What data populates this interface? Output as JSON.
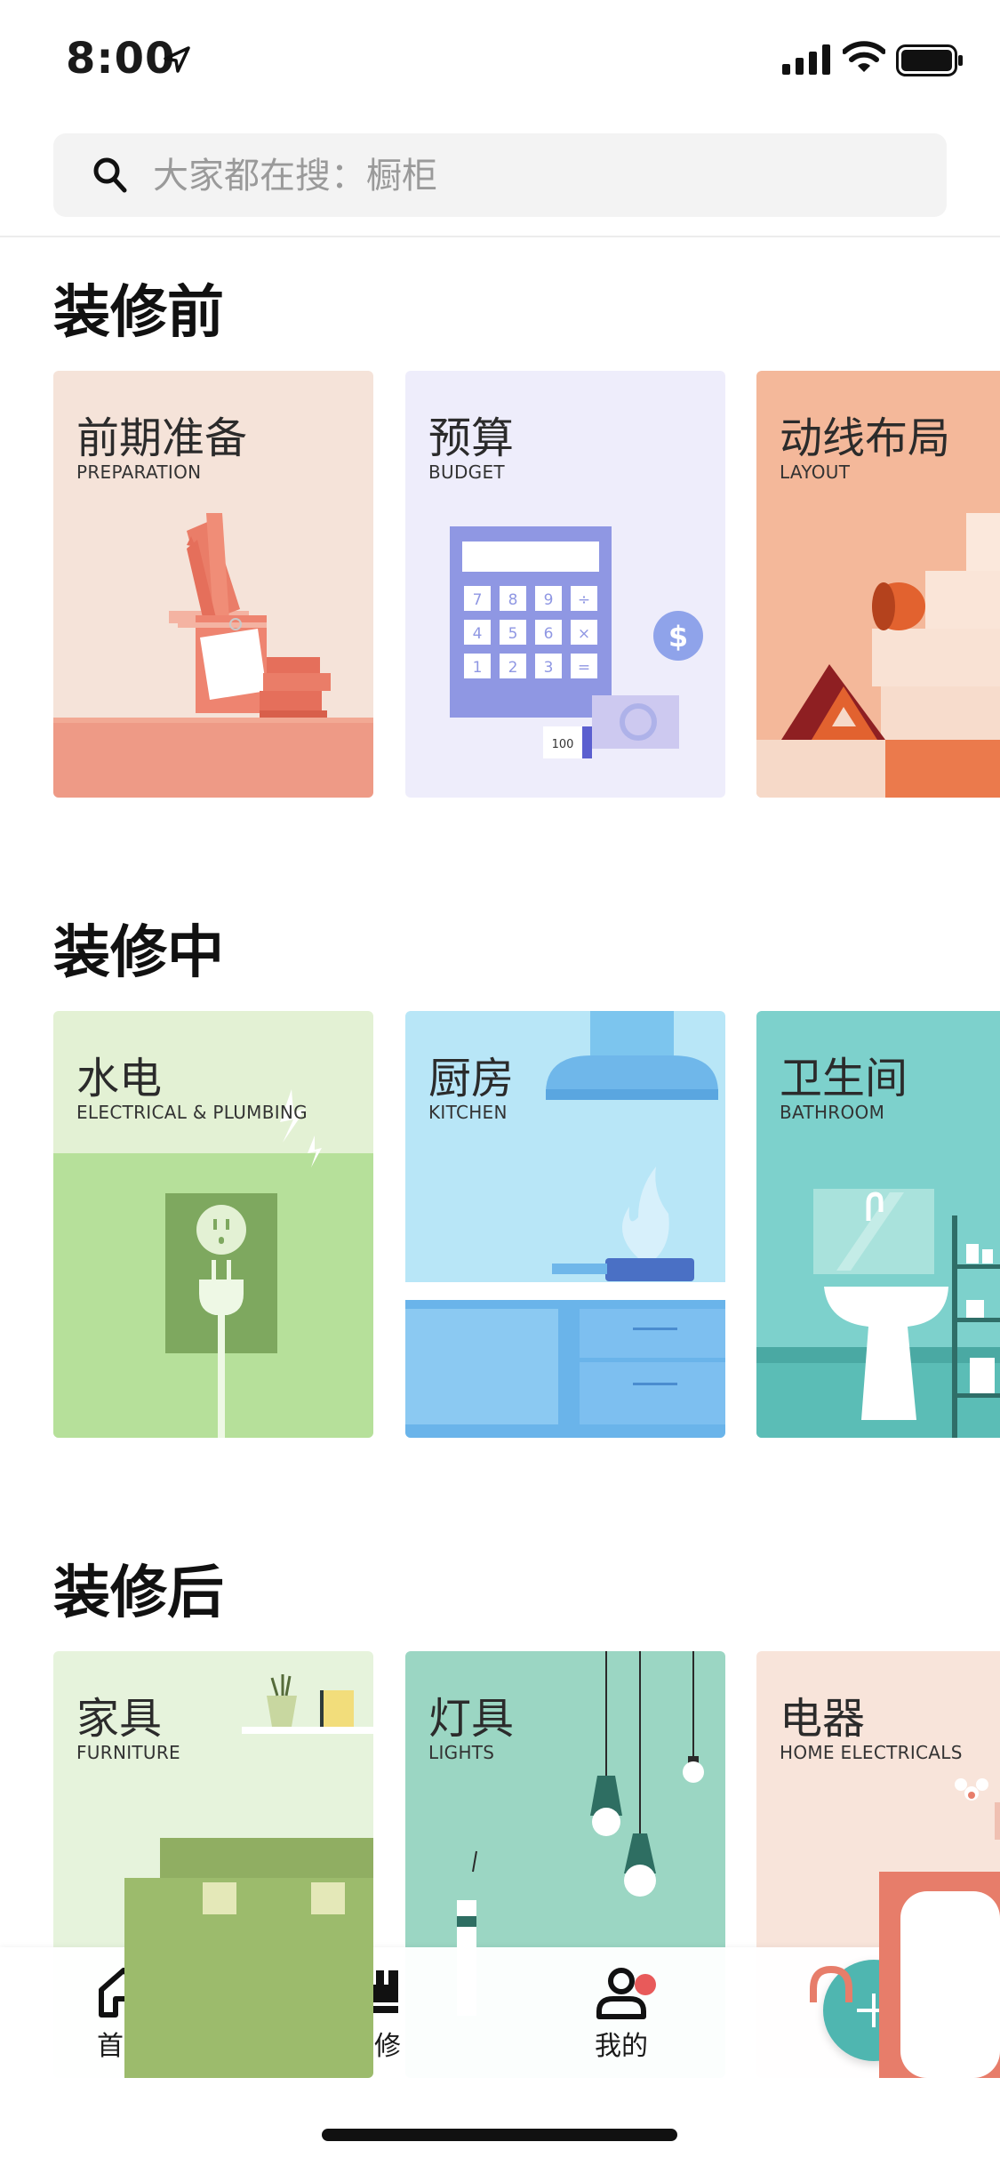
{
  "status_bar": {
    "time": "8:00"
  },
  "search": {
    "placeholder": "大家都在搜：橱柜"
  },
  "sections": [
    {
      "title": "装修前",
      "cards": [
        {
          "title": "前期准备",
          "subtitle": "PREPARATION",
          "bg": "#f5e3d9"
        },
        {
          "title": "预算",
          "subtitle": "BUDGET",
          "bg": "#eeedfb"
        },
        {
          "title": "动线布局",
          "subtitle": "LAYOUT",
          "bg": "#f4b89a"
        }
      ]
    },
    {
      "title": "装修中",
      "cards": [
        {
          "title": "水电",
          "subtitle": "ELECTRICAL & PLUMBING",
          "bg": "#e3f1d4"
        },
        {
          "title": "厨房",
          "subtitle": "KITCHEN",
          "bg": "#b8e6f7"
        },
        {
          "title": "卫生间",
          "subtitle": "BATHROOM",
          "bg": "#7dd1cc"
        }
      ]
    },
    {
      "title": "装修后",
      "cards": [
        {
          "title": "家具",
          "subtitle": "FURNITURE",
          "bg": "#e6f3dc"
        },
        {
          "title": "灯具",
          "subtitle": "LIGHTS",
          "bg": "#9bd6c3"
        },
        {
          "title": "电器",
          "subtitle": "HOME ELECTRICALS",
          "bg": "#f8e4da"
        }
      ]
    }
  ],
  "budget_illustration": {
    "keys": [
      "7",
      "8",
      "9",
      "÷",
      "4",
      "5",
      "6",
      "×",
      "1",
      "2",
      "3",
      "="
    ],
    "receipt": "100",
    "coin": "$"
  },
  "tab_bar": {
    "items": [
      {
        "label": "首页",
        "icon": "home-icon"
      },
      {
        "label": "装修",
        "icon": "roller-icon"
      },
      {
        "label": "我的",
        "icon": "user-icon"
      }
    ],
    "fab_label": "+"
  },
  "colors": {
    "accent": "#4fb6b0",
    "badge": "#e85a5a",
    "search_bg": "#f3f3f3"
  }
}
